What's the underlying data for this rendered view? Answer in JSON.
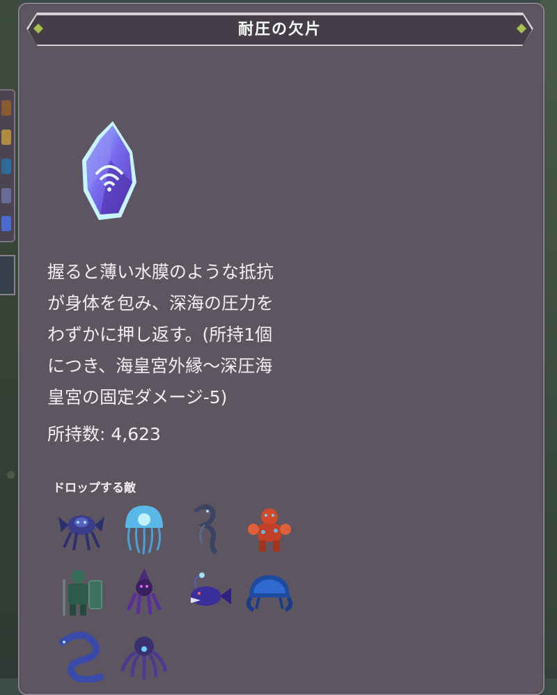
{
  "item": {
    "name": "耐圧の欠片",
    "description": "握ると薄い水膜のような抵抗\nが身体を包み、深海の圧力を\nわずかに押し返す。(所持1個\nにつき、海皇宮外縁〜深圧海\n皇宮の固定ダメージ-5)",
    "count_label": "所持数:",
    "count_value": "4,623",
    "icon": "pressure-shard-crystal-icon"
  },
  "drops": {
    "title": "ドロップする敵",
    "enemies": [
      {
        "icon": "abyssal-crab-enemy-icon"
      },
      {
        "icon": "glowing-jellyfish-enemy-icon"
      },
      {
        "icon": "dark-seahorse-enemy-icon"
      },
      {
        "icon": "red-coral-golem-enemy-icon"
      },
      {
        "icon": "armored-fishman-knight-enemy-icon"
      },
      {
        "icon": "shadow-squid-mage-enemy-icon"
      },
      {
        "icon": "anglerfish-enemy-icon"
      },
      {
        "icon": "blue-giant-crab-enemy-icon"
      },
      {
        "icon": "deep-sea-eel-enemy-icon"
      },
      {
        "icon": "abyssal-octopus-enemy-icon"
      }
    ]
  },
  "colors": {
    "panel_bg": "#5d5660",
    "title_bar_bg": "#433e47",
    "title_gem": "#a8c050",
    "text": "#f2eef2"
  }
}
